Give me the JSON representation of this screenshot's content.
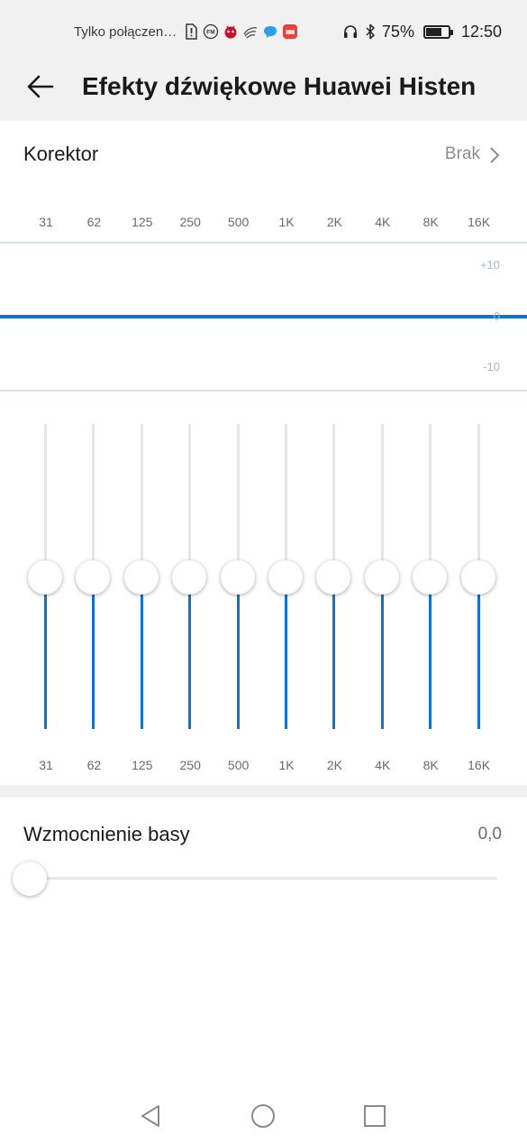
{
  "status_bar": {
    "carrier": "Tylko połączen…",
    "battery": "75%",
    "battery_level": 0.75,
    "time": "12:50",
    "left_icons": [
      "sim-alert-icon",
      "fm-radio-icon",
      "antutu-icon",
      "swiftkey-icon",
      "messenger-icon",
      "huawei-store-icon"
    ],
    "right_icons": [
      "headphones-icon",
      "bluetooth-icon",
      "battery-icon"
    ]
  },
  "header": {
    "title": "Efekty dźwiękowe Huawei Histen",
    "back_icon": "arrow-left-icon"
  },
  "equalizer": {
    "label": "Korektor",
    "preset": "Brak",
    "bands": [
      "31",
      "62",
      "125",
      "250",
      "500",
      "1K",
      "2K",
      "4K",
      "8K",
      "16K"
    ],
    "gains_db": [
      0,
      0,
      0,
      0,
      0,
      0,
      0,
      0,
      0,
      0
    ],
    "curve_labels": {
      "max": "+10",
      "mid": "0",
      "min": "-10"
    },
    "accent": "#1473c9",
    "gridline": "#c9d9ee"
  },
  "bass": {
    "label": "Wzmocnienie basy",
    "value": "0,0",
    "level": 0
  },
  "nav": {
    "icons": [
      "back-triangle-icon",
      "home-circle-icon",
      "recents-square-icon"
    ]
  }
}
